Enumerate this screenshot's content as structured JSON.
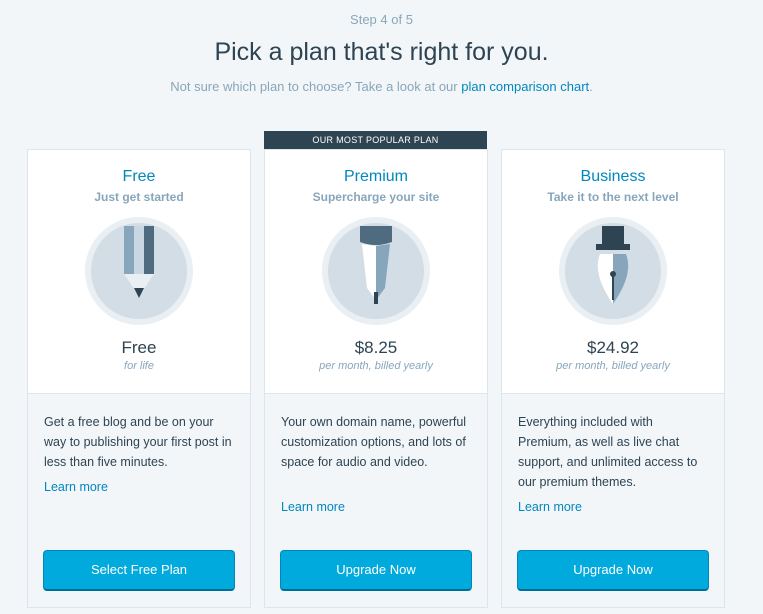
{
  "header": {
    "step": "Step 4 of 5",
    "title": "Pick a plan that's right for you.",
    "subtitle_prefix": "Not sure which plan to choose? Take a look at our ",
    "subtitle_link": "plan comparison chart",
    "subtitle_suffix": "."
  },
  "popular_banner": "OUR MOST POPULAR PLAN",
  "plans": [
    {
      "name": "Free",
      "tagline": "Just get started",
      "icon": "pencil-icon",
      "price": "Free",
      "period": "for life",
      "description": "Get a free blog and be on your way to publishing your first post in less than five minutes.",
      "learn_more": "Learn more",
      "button": "Select Free Plan"
    },
    {
      "name": "Premium",
      "tagline": "Supercharge your site",
      "icon": "pen-icon",
      "price": "$8.25",
      "period": "per month, billed yearly",
      "description": "Your own domain name, powerful customization options, and lots of space for audio and video.",
      "learn_more": "Learn more",
      "button": "Upgrade Now"
    },
    {
      "name": "Business",
      "tagline": "Take it to the next level",
      "icon": "fountain-pen-icon",
      "price": "$24.92",
      "period": "per month, billed yearly",
      "description": "Everything included with Premium, as well as live chat support, and unlimited access to our premium themes.",
      "learn_more": "Learn more",
      "button": "Upgrade Now"
    }
  ],
  "colors": {
    "accent": "#0087be",
    "button": "#00aadc",
    "dark": "#2e4453",
    "muted": "#87a6bc",
    "background": "#f3f6f8"
  }
}
